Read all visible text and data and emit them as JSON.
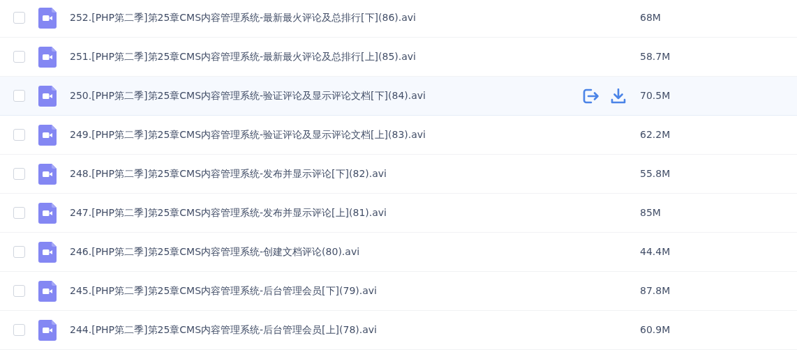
{
  "files": [
    {
      "name": "252.[PHP第二季]第25章CMS内容管理系统-最新最火评论及总排行[下](86).avi",
      "size": "68M",
      "checked": false,
      "hovered": false
    },
    {
      "name": "251.[PHP第二季]第25章CMS内容管理系统-最新最火评论及总排行[上](85).avi",
      "size": "58.7M",
      "checked": false,
      "hovered": false
    },
    {
      "name": "250.[PHP第二季]第25章CMS内容管理系统-验证评论及显示评论文档[下](84).avi",
      "size": "70.5M",
      "checked": false,
      "hovered": true
    },
    {
      "name": "249.[PHP第二季]第25章CMS内容管理系统-验证评论及显示评论文档[上](83).avi",
      "size": "62.2M",
      "checked": false,
      "hovered": false
    },
    {
      "name": "248.[PHP第二季]第25章CMS内容管理系统-发布并显示评论[下](82).avi",
      "size": "55.8M",
      "checked": false,
      "hovered": false
    },
    {
      "name": "247.[PHP第二季]第25章CMS内容管理系统-发布并显示评论[上](81).avi",
      "size": "85M",
      "checked": false,
      "hovered": false
    },
    {
      "name": "246.[PHP第二季]第25章CMS内容管理系统-创建文档评论(80).avi",
      "size": "44.4M",
      "checked": false,
      "hovered": false
    },
    {
      "name": "245.[PHP第二季]第25章CMS内容管理系统-后台管理会员[下](79).avi",
      "size": "87.8M",
      "checked": false,
      "hovered": false
    },
    {
      "name": "244.[PHP第二季]第25章CMS内容管理系统-后台管理会员[上](78).avi",
      "size": "60.9M",
      "checked": false,
      "hovered": false
    }
  ]
}
